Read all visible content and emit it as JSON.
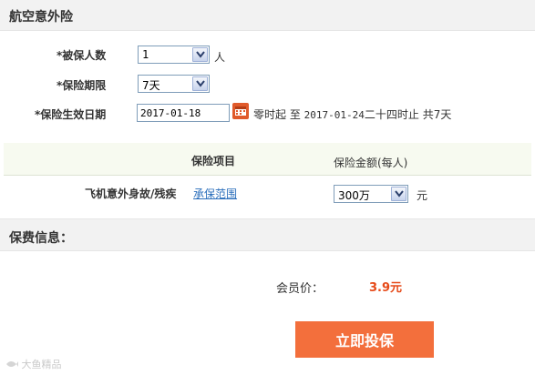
{
  "section1": {
    "title": "航空意外险"
  },
  "form": {
    "insured_count": {
      "label": "*被保人数",
      "value": "1",
      "unit": "人"
    },
    "period": {
      "label": "*保险期限",
      "value": "7天"
    },
    "effective_date": {
      "label": "*保险生效日期",
      "value": "2017-01-18",
      "note_prefix": "零时起 至",
      "end_date": "2017-01-24",
      "note_suffix": "二十四时止 共7天"
    }
  },
  "coverage_table": {
    "headers": [
      "保险项目",
      "保险金额(每人)"
    ],
    "rows": [
      {
        "item": "飞机意外身故/残疾",
        "link": "承保范围",
        "amount": "300万",
        "unit": "元"
      }
    ]
  },
  "section2": {
    "title": "保费信息："
  },
  "premium": {
    "label": "会员价：",
    "value": "3.9元"
  },
  "cta": {
    "label": "立即投保"
  },
  "watermark": {
    "text": "大鱼精品"
  },
  "colors": {
    "accent": "#f36f3c",
    "price": "#e64a19",
    "link": "#2a6ebb"
  }
}
